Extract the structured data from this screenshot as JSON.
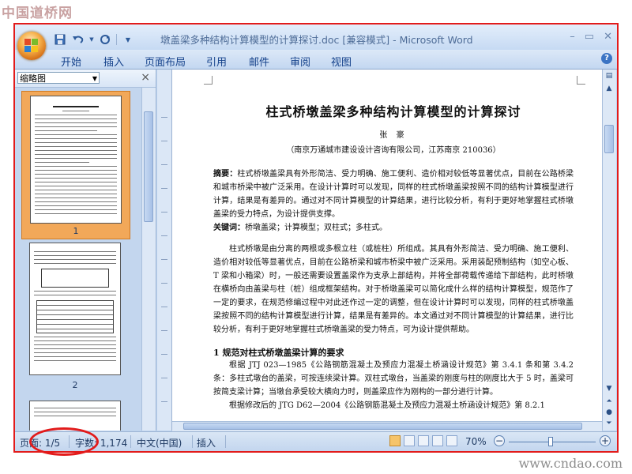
{
  "watermarks": {
    "top": "中国道桥网",
    "bottom": "www.cndao.com"
  },
  "window": {
    "title": "墩盖梁多种结构计算模型的计算探讨.doc [兼容模式] - Microsoft Word",
    "help_label": "?"
  },
  "ribbon_tabs": [
    "开始",
    "插入",
    "页面布局",
    "引用",
    "邮件",
    "审阅",
    "视图"
  ],
  "nav_pane": {
    "view_selected": "缩略图",
    "close_label": "×",
    "thumbnails": [
      {
        "page": "1",
        "selected": true
      },
      {
        "page": "2",
        "selected": false
      }
    ]
  },
  "document": {
    "title": "柱式桥墩盖梁多种结构计算模型的计算探讨",
    "author": "张 豪",
    "affiliation": "（南京万通城市建设设计咨询有限公司，江苏南京 210036）",
    "abstract_label": "摘要：",
    "abstract": "柱式桥墩盖梁具有外形简洁、受力明确、施工便利、造价相对较低等显著优点，目前在公路桥梁和城市桥梁中被广泛采用。在设计计算时可以发现，同样的柱式桥墩盖梁按照不同的结构计算模型进行计算，结果是有差异的。通过对不同计算模型的计算结果，进行比较分析，有利于更好地掌握柱式桥墩盖梁的受力特点，为设计提供支撑。",
    "keywords_label": "关键词：",
    "keywords": "桥墩盖梁；计算模型；双柱式；多柱式。",
    "intro": "柱式桥墩是由分离的两根或多根立柱（或桩柱）所组成。其具有外形简洁、受力明确、施工便利、造价相对较低等显著优点，目前在公路桥梁和城市桥梁中被广泛采用。采用装配预制结构（如空心板、T 梁和小箱梁）时，一般还需要设置盖梁作为支承上部结构，并将全部荷载传递给下部结构，此时桥墩在横桥向由盖梁与柱（桩）组成框架结构。对于桥墩盖梁可以简化成什么样的结构计算模型，规范作了一定的要求，在规范修编过程中对此还作过一定的调整，但在设计计算时可以发现，同样的柱式桥墩盖梁按照不同的结构计算模型进行计算，结果是有差异的。本文通过对不同计算模型的计算结果，进行比较分析，有利于更好地掌握柱式桥墩盖梁的受力特点，可为设计提供帮助。",
    "section1_title": "1 规范对柱式桥墩盖梁计算的要求",
    "section1_p1": "根据 JTJ 023—1985《公路钢筋混凝土及预应力混凝土桥涵设计规范》第 3.4.1 条和第 3.4.2 条：多柱式墩台的盖梁，可按连续梁计算。双柱式墩台，当盖梁的刚度与柱的刚度比大于 5 时，盖梁可按简支梁计算；当墩台承受较大横向力时，则盖梁应作为刚构的一部分进行计算。",
    "section1_p2": "根据修改后的 JTG D62—2004《公路钢筋混凝土及预应力混凝土桥涵设计规范》第 8.2.1"
  },
  "status_bar": {
    "page": "页面: 1/5",
    "words": "字数: 1,174",
    "language": "中文(中国)",
    "mode": "插入",
    "zoom": "70%",
    "zoom_percent": 70
  },
  "colors": {
    "annotation": "#e21b1b",
    "frame": "#e21b1b",
    "selected_thumb": "#f2a859"
  }
}
